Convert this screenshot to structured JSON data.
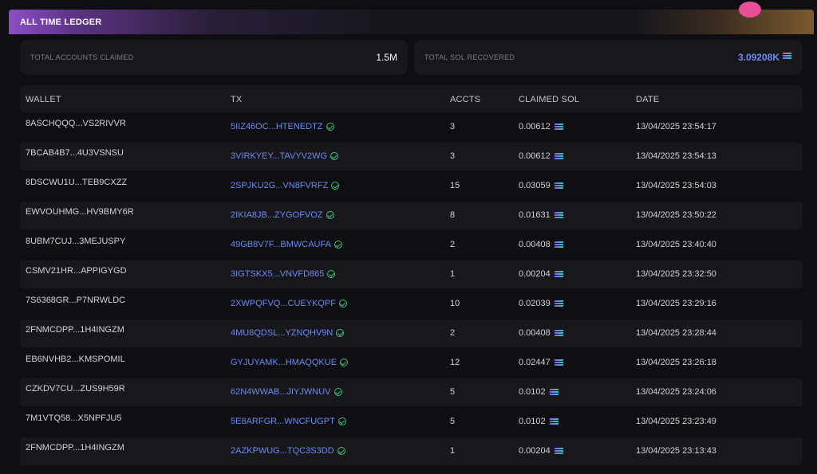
{
  "header": {
    "title": "ALL TIME LEDGER"
  },
  "stats": {
    "accounts": {
      "label": "TOTAL ACCOUNTS CLAIMED",
      "value": "1.5M"
    },
    "sol": {
      "label": "TOTAL SOL RECOVERED",
      "value": "3.09208K",
      "icon": "solana-icon"
    }
  },
  "table": {
    "headers": {
      "wallet": "WALLET",
      "tx": "TX",
      "accts": "ACCTS",
      "claimed": "CLAIMED SOL",
      "date": "DATE"
    },
    "rows": [
      {
        "wallet": "8ASCHQQQ...VS2RIVVR",
        "tx": "5IIZ46OC...HTENEDTZ",
        "accts": "3",
        "sol": "0.00612",
        "date": "13/04/2025 23:54:17"
      },
      {
        "wallet": "7BCAB4B7...4U3VSNSU",
        "tx": "3VIRKYEY...TAVYV2WG",
        "accts": "3",
        "sol": "0.00612",
        "date": "13/04/2025 23:54:13"
      },
      {
        "wallet": "8DSCWU1U...TEB9CXZZ",
        "tx": "2SPJKU2G...VN8FVRFZ",
        "accts": "15",
        "sol": "0.03059",
        "date": "13/04/2025 23:54:03"
      },
      {
        "wallet": "EWVOUHMG...HV9BMY6R",
        "tx": "2IKIA8JB...ZYGOFVOZ",
        "accts": "8",
        "sol": "0.01631",
        "date": "13/04/2025 23:50:22"
      },
      {
        "wallet": "8UBM7CUJ...3MEJUSPY",
        "tx": "49GB8V7F...BMWCAUFA",
        "accts": "2",
        "sol": "0.00408",
        "date": "13/04/2025 23:40:40"
      },
      {
        "wallet": "CSMV21HR...APPIGYGD",
        "tx": "3IGTSKX5...VNVFD865",
        "accts": "1",
        "sol": "0.00204",
        "date": "13/04/2025 23:32:50"
      },
      {
        "wallet": "7S6368GR...P7NRWLDC",
        "tx": "2XWPQFVQ...CUEYKQPF",
        "accts": "10",
        "sol": "0.02039",
        "date": "13/04/2025 23:29:16"
      },
      {
        "wallet": "2FNMCDPP...1H4INGZM",
        "tx": "4MU8QDSL...YZNQHV9N",
        "accts": "2",
        "sol": "0.00408",
        "date": "13/04/2025 23:28:44"
      },
      {
        "wallet": "EB6NVHB2...KMSPOMIL",
        "tx": "GYJUYAMK...HMAQQKUE",
        "accts": "12",
        "sol": "0.02447",
        "date": "13/04/2025 23:26:18"
      },
      {
        "wallet": "CZKDV7CU...ZUS9H59R",
        "tx": "62N4WWAB...JIYJWNUV",
        "accts": "5",
        "sol": "0.0102",
        "date": "13/04/2025 23:24:06"
      },
      {
        "wallet": "7M1VTQ58...X5NPFJU5",
        "tx": "5E8ARFGR...WNCFUGPT",
        "accts": "5",
        "sol": "0.0102",
        "date": "13/04/2025 23:23:49"
      },
      {
        "wallet": "2FNMCDPP...1H4INGZM",
        "tx": "2AZKPWUG...TQC3S3DD",
        "accts": "1",
        "sol": "0.00204",
        "date": "13/04/2025 23:13:43"
      }
    ]
  },
  "colors": {
    "accent": "#6d8cf6",
    "success": "#3fc277",
    "background": "#0f0f13",
    "card": "#17171c"
  }
}
